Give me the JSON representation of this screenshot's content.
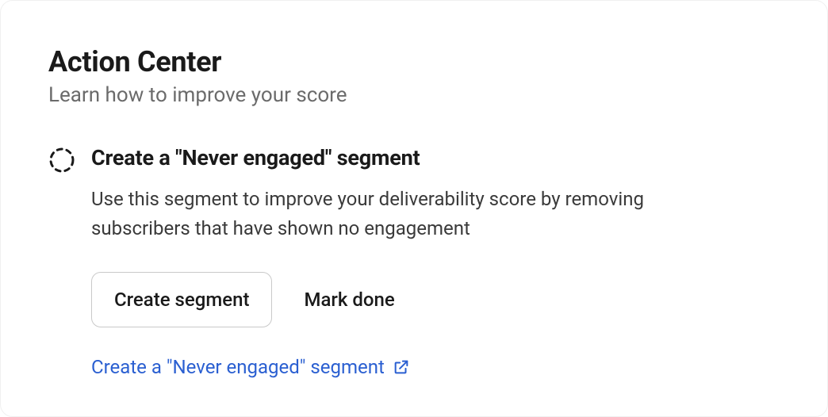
{
  "header": {
    "title": "Action Center",
    "subtitle": "Learn how to improve your score"
  },
  "action": {
    "title": "Create a \"Never engaged\" segment",
    "description": "Use this segment to improve your deliverability score by removing subscribers that have shown no engagement",
    "primary_button_label": "Create segment",
    "secondary_button_label": "Mark done",
    "link_label": "Create a \"Never engaged\" segment"
  },
  "colors": {
    "link": "#2a5fd1",
    "text_primary": "#1a1a1a",
    "text_secondary": "#6b6b6b"
  }
}
